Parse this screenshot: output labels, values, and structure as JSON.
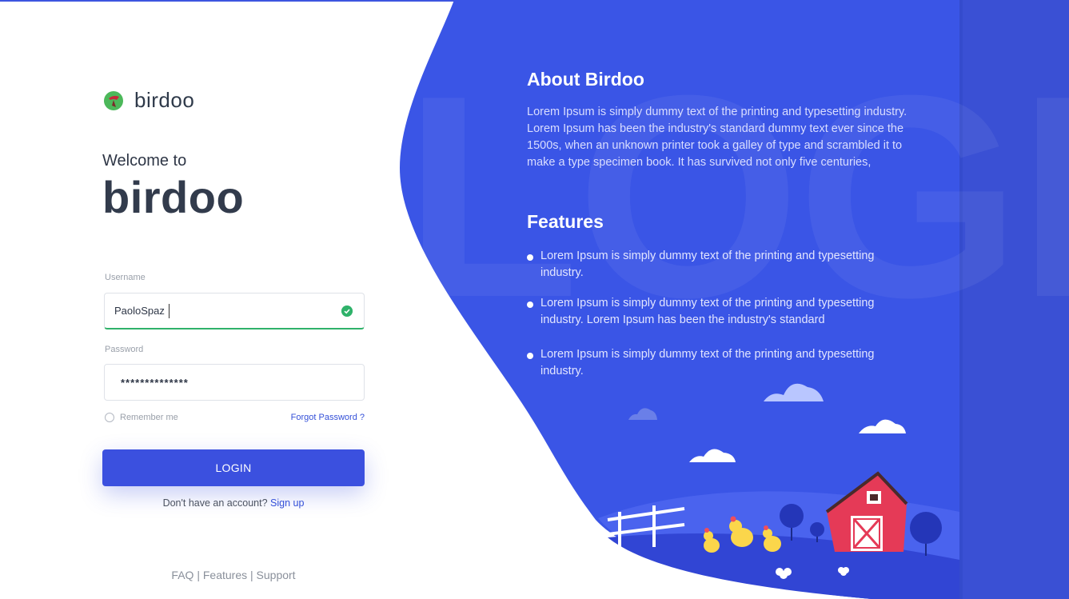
{
  "brand": {
    "logo_text": "birdoo"
  },
  "login": {
    "welcome": "Welcome to",
    "brand_name": "birdoo",
    "username_label": "Username",
    "username_value": "PaoloSpaz",
    "password_label": "Password",
    "password_value": "**************",
    "remember_label": "Remember me",
    "forgot_label": "Forgot Password ?",
    "login_button": "LOGIN",
    "signup_prompt": "Don't have an account?",
    "signup_link": "Sign up"
  },
  "footer": {
    "links": [
      "FAQ",
      "Features",
      "Support"
    ],
    "separator": "|"
  },
  "info": {
    "watermark": "LOGIN",
    "about_title": "About Birdoo",
    "about_body": "Lorem Ipsum is simply dummy text of the printing and typesetting industry. Lorem Ipsum has been the industry's standard dummy text ever since the 1500s, when an unknown printer took a galley of type and scrambled it to make a type specimen book. It has survived not only five centuries,",
    "features_title": "Features",
    "features": [
      "Lorem Ipsum is simply dummy text of the printing and typesetting industry.",
      "Lorem Ipsum is simply dummy text of the printing and typesetting industry. Lorem Ipsum has been the industry's standard",
      "Lorem Ipsum is simply dummy text of the printing and typesetting industry."
    ]
  },
  "colors": {
    "accent": "#3b50df",
    "panel": "#3a55e6",
    "success": "#2fb26a",
    "link": "#3450d8"
  },
  "icons": {
    "logo": "birdoo-logo-icon",
    "valid": "check-circle-icon",
    "bullet": "bullet-dot-icon"
  }
}
